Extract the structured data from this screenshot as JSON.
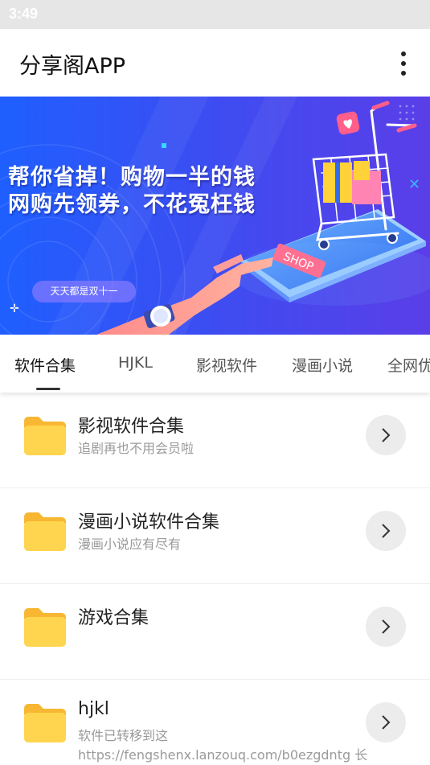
{
  "status_bar": {
    "time": "3:49"
  },
  "app_bar": {
    "title": "分享阁APP",
    "menu_icon": "more-vertical-icon"
  },
  "banner": {
    "line1": "帮你省掉！购物一半的钱",
    "line2": "网购先领券，不花冤枉钱",
    "pill": "天天都是双十一",
    "shop_label": "SHOP",
    "colors": {
      "gradient_start": "#1f5fff",
      "gradient_end": "#5b3ee8"
    }
  },
  "tabs": [
    {
      "label": "软件合集",
      "active": true
    },
    {
      "label": "HJKL",
      "active": false
    },
    {
      "label": "影视软件",
      "active": false
    },
    {
      "label": "漫画小说",
      "active": false
    },
    {
      "label": "全网优",
      "active": false
    }
  ],
  "list": [
    {
      "title": "影视软件合集",
      "subtitle": "追剧再也不用会员啦",
      "icon": "folder-icon"
    },
    {
      "title": "漫画小说软件合集",
      "subtitle": "漫画小说应有尽有",
      "icon": "folder-icon"
    },
    {
      "title": "游戏合集",
      "subtitle": "",
      "icon": "folder-icon"
    },
    {
      "title": "hjkl",
      "subtitle": "软件已转移到这",
      "extra": "https://fengshenx.lanzouq.com/b0ezgdntg 长",
      "icon": "folder-icon"
    }
  ],
  "colors": {
    "folder": "#ffd54f",
    "folder_tab": "#f7b733",
    "accent_blue": "#2f5bf5"
  }
}
